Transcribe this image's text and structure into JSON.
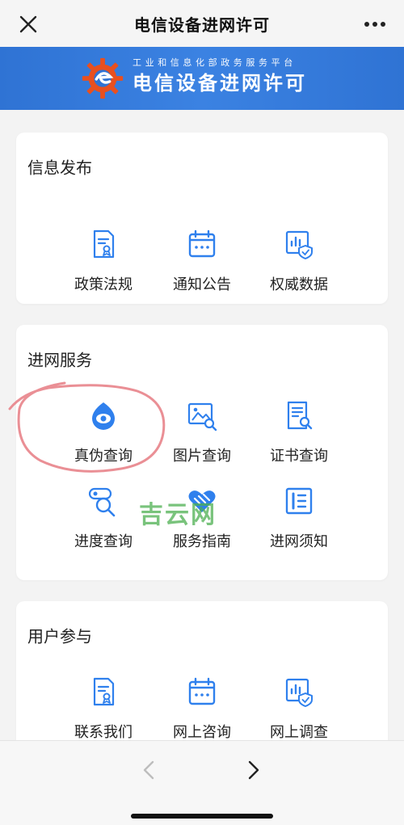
{
  "header": {
    "title": "电信设备进网许可"
  },
  "banner": {
    "subtitle": "工业和信息化部政务服务平台",
    "title": "电信设备进网许可"
  },
  "sections": [
    {
      "title": "信息发布",
      "items": [
        {
          "label": "政策法规",
          "icon": "policy-document-icon"
        },
        {
          "label": "通知公告",
          "icon": "calendar-icon"
        },
        {
          "label": "权威数据",
          "icon": "data-shield-icon"
        }
      ]
    },
    {
      "title": "进网服务",
      "items": [
        {
          "label": "真伪查询",
          "icon": "eye-drop-icon"
        },
        {
          "label": "图片查询",
          "icon": "image-search-icon"
        },
        {
          "label": "证书查询",
          "icon": "certificate-search-icon"
        },
        {
          "label": "进度查询",
          "icon": "progress-search-icon"
        },
        {
          "label": "服务指南",
          "icon": "heart-hands-icon"
        },
        {
          "label": "进网须知",
          "icon": "notice-list-icon"
        }
      ]
    },
    {
      "title": "用户参与",
      "items": [
        {
          "label": "联系我们",
          "icon": "policy-document-icon"
        },
        {
          "label": "网上咨询",
          "icon": "calendar-icon"
        },
        {
          "label": "网上调查",
          "icon": "data-shield-icon"
        }
      ]
    }
  ],
  "watermark": "吉云网",
  "colors": {
    "banner": "#3b82e2",
    "icon": "#2f80ed",
    "annotation": "#e8838a",
    "watermark": "#4caf50"
  }
}
